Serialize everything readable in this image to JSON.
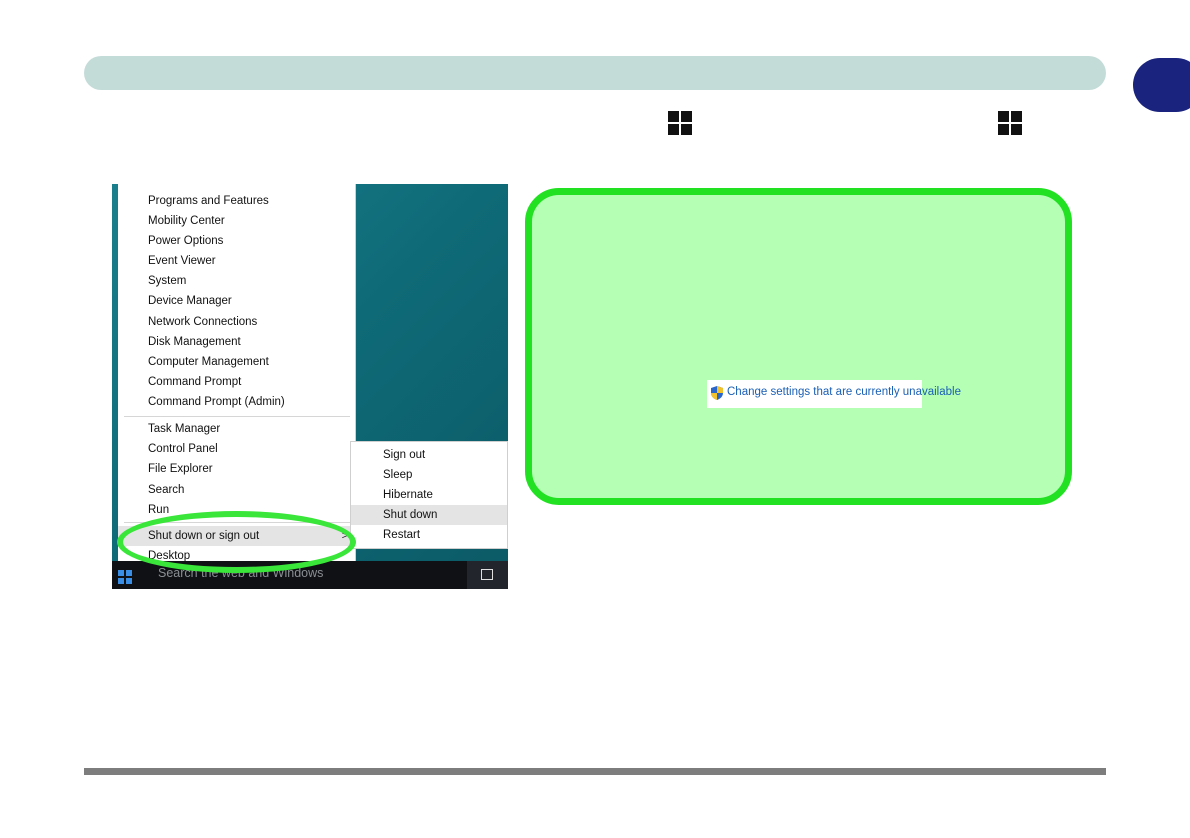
{
  "context_menu": {
    "group1": [
      "Programs and Features",
      "Mobility Center",
      "Power Options",
      "Event Viewer",
      "System",
      "Device Manager",
      "Network Connections",
      "Disk Management",
      "Computer Management",
      "Command Prompt",
      "Command Prompt (Admin)"
    ],
    "group2": [
      "Task Manager",
      "Control Panel",
      "File Explorer",
      "Search",
      "Run"
    ],
    "shutdown_label": "Shut down or sign out",
    "shutdown_chevron": ">",
    "desktop_label": "Desktop"
  },
  "submenu": {
    "items": [
      "Sign out",
      "Sleep",
      "Hibernate",
      "Shut down",
      "Restart"
    ]
  },
  "taskbar": {
    "search_placeholder": "Search the web and Windows",
    "icons": [
      "windows-start-icon",
      "task-view-icon"
    ]
  },
  "note": {
    "change_settings_link": "Change settings that are currently unavailable",
    "icons": [
      "shield-icon"
    ]
  },
  "colors": {
    "note_fill": "#b5ffb5",
    "note_border": "#22e022",
    "highlight_ellipse": "#39e639",
    "header_bar": "#c4dcd8",
    "chapter_tab": "#1a237e"
  }
}
